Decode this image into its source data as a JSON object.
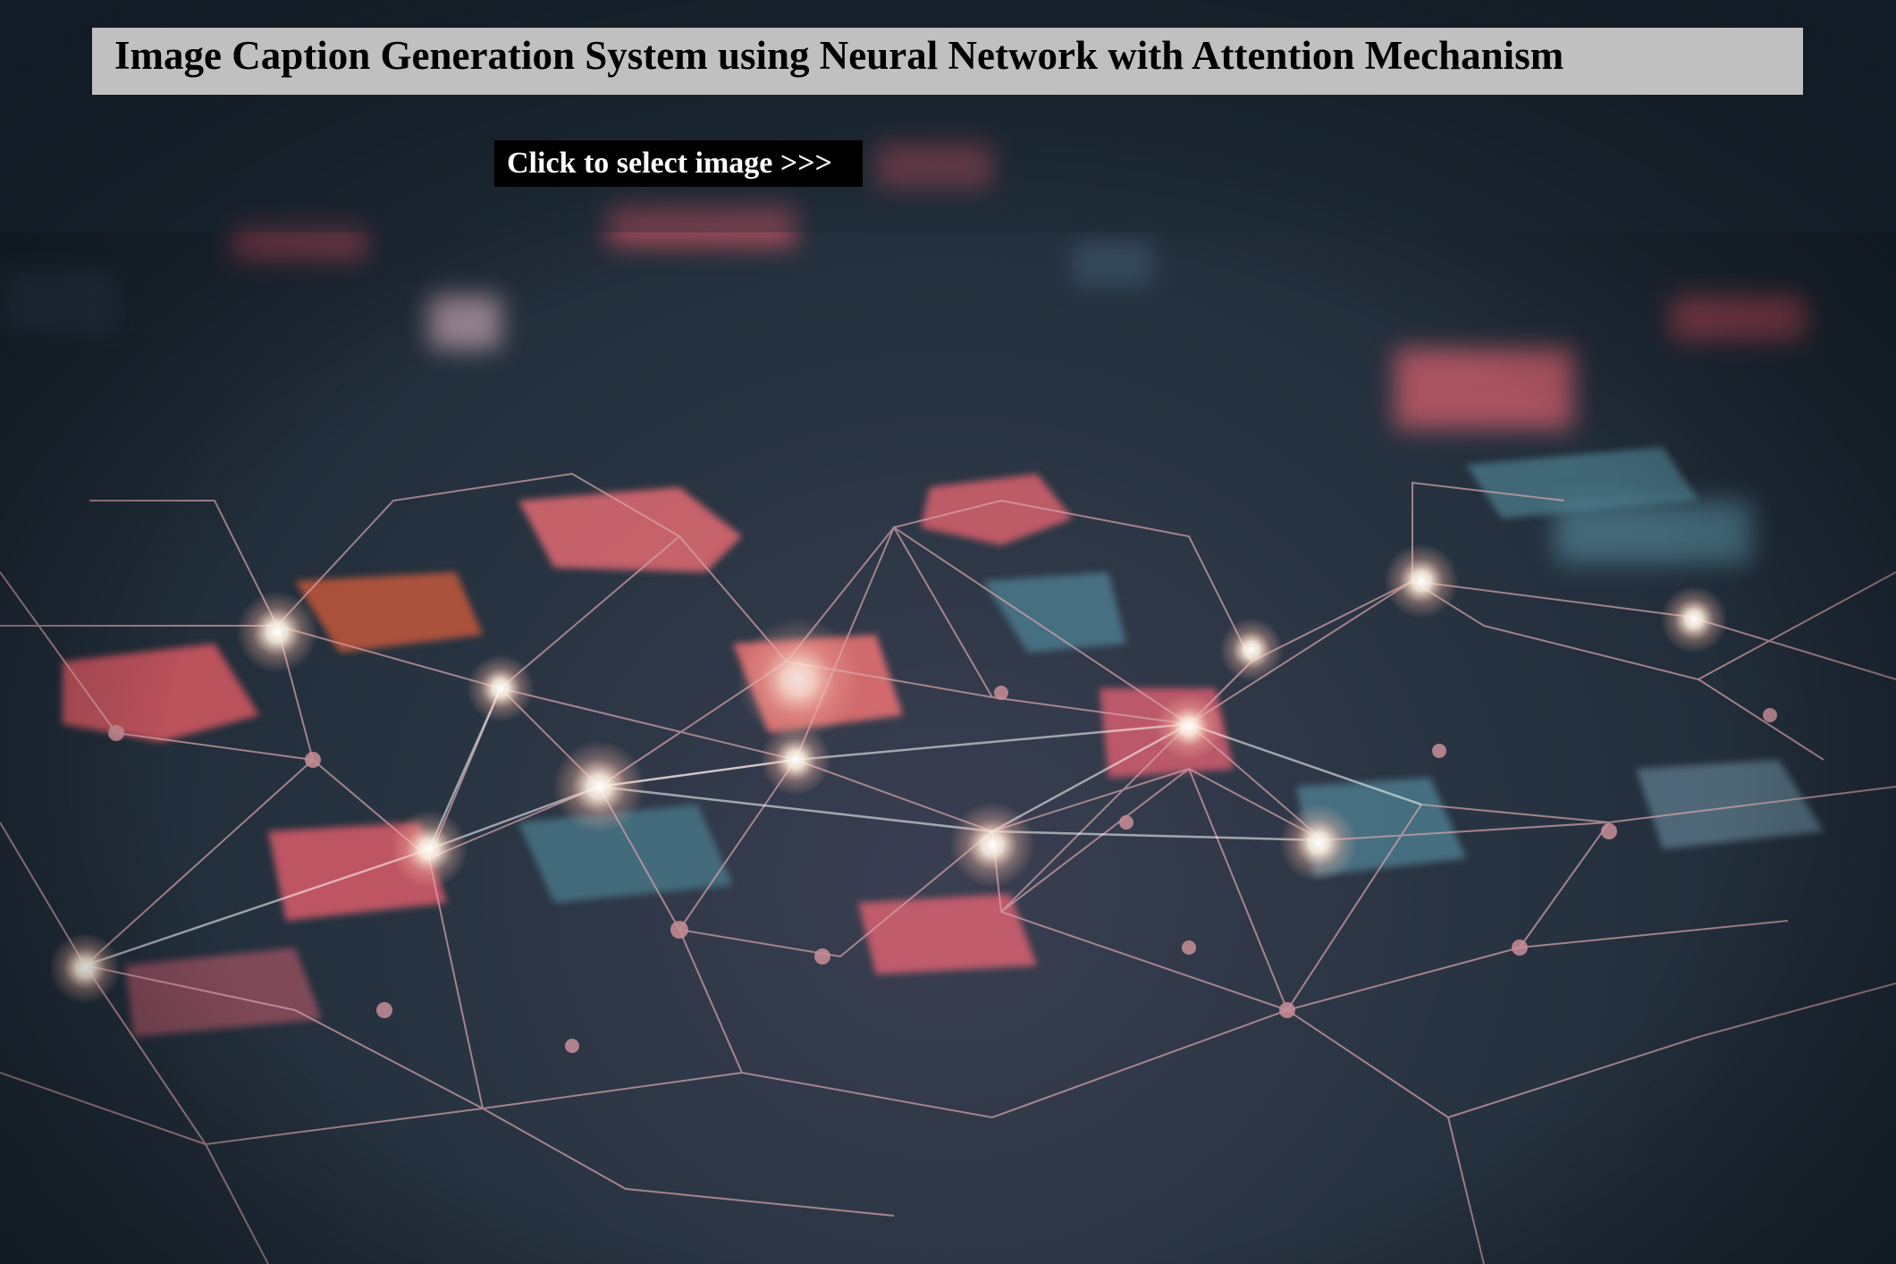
{
  "header": {
    "title": "Image Caption Generation System using Neural Network with Attention Mechanism"
  },
  "actions": {
    "select_image_label": "Click to select image >>>"
  },
  "background": {
    "description_icon": "neural-network-background-icon",
    "colors": {
      "base": "#1c2a37",
      "accent_red": "#e0566a",
      "accent_teal": "#4a8a9a",
      "glow": "#fff4e6",
      "line": "#d9a0a8"
    }
  }
}
